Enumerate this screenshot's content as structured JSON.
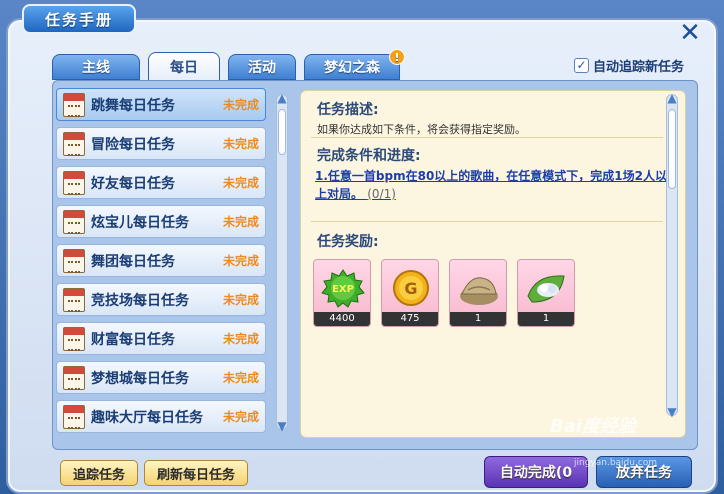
{
  "window": {
    "title": "任务手册",
    "close_symbol": "✕"
  },
  "tabs": [
    {
      "label": "主线",
      "active": false
    },
    {
      "label": "每日",
      "active": true
    },
    {
      "label": "活动",
      "active": false
    },
    {
      "label": "梦幻之森",
      "active": false,
      "badge": "!"
    }
  ],
  "auto_track": {
    "checked": true,
    "check_mark": "✓",
    "label": "自动追踪新任务"
  },
  "task_list": {
    "items": [
      {
        "name": "跳舞每日任务",
        "status": "未完成",
        "icon": "calendar-icon",
        "selected": true
      },
      {
        "name": "冒险每日任务",
        "status": "未完成",
        "icon": "calendar-icon"
      },
      {
        "name": "好友每日任务",
        "status": "未完成",
        "icon": "calendar-icon"
      },
      {
        "name": "炫宝儿每日任务",
        "status": "未完成",
        "icon": "calendar-icon"
      },
      {
        "name": "舞团每日任务",
        "status": "未完成",
        "icon": "calendar-icon"
      },
      {
        "name": "竞技场每日任务",
        "status": "未完成",
        "icon": "calendar-icon"
      },
      {
        "name": "财富每日任务",
        "status": "未完成",
        "icon": "calendar-icon"
      },
      {
        "name": "梦想城每日任务",
        "status": "未完成",
        "icon": "calendar-icon"
      },
      {
        "name": "趣味大厅每日任务",
        "status": "未完成",
        "icon": "calendar-icon"
      }
    ]
  },
  "detail": {
    "desc_title": "任务描述:",
    "desc_text": "如果你达成如下条件，将会获得指定奖励。",
    "cond_title": "完成条件和进度:",
    "cond_text": "1.任意一首bpm在80以上的歌曲，在任意模式下，完成1场2人以上对局。",
    "cond_progress": "(0/1)",
    "reward_title": "任务奖励:",
    "rewards": [
      {
        "icon": "exp-orb-icon",
        "label": "EXP",
        "count": "4400"
      },
      {
        "icon": "gold-coin-icon",
        "label": "G",
        "count": "475"
      },
      {
        "icon": "cloth-bundle-icon",
        "count": "1"
      },
      {
        "icon": "leaf-item-icon",
        "count": "1"
      }
    ]
  },
  "buttons": {
    "track": "追踪任务",
    "refresh": "刷新每日任务",
    "auto_complete": "自动完成(0",
    "abandon": "放弃任务"
  },
  "watermark": {
    "text": "Bai度经验",
    "sub": "jingyan.baidu.com"
  }
}
